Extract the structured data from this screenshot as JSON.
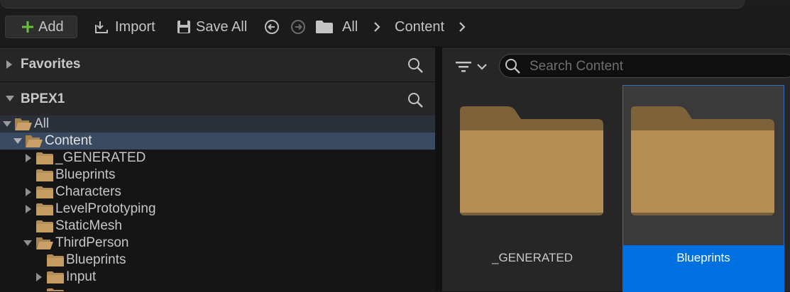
{
  "toolbar": {
    "add_label": "Add",
    "import_label": "Import",
    "save_all_label": "Save All",
    "breadcrumb": [
      "All",
      "Content"
    ]
  },
  "sources": {
    "favorites_label": "Favorites",
    "project_label": "BPEX1"
  },
  "tree": {
    "all": "All",
    "content": "Content",
    "generated": "_GENERATED",
    "blueprints": "Blueprints",
    "characters": "Characters",
    "level_prototyping": "LevelPrototyping",
    "static_mesh": "StaticMesh",
    "third_person": "ThirdPerson",
    "tp_blueprints": "Blueprints",
    "tp_input": "Input"
  },
  "content": {
    "search_placeholder": "Search Content",
    "tiles": [
      "_GENERATED",
      "Blueprints"
    ]
  },
  "colors": {
    "accent_selected": "#0070e0",
    "folder": "#b58e56",
    "tree_selection": "#3a4b61"
  }
}
